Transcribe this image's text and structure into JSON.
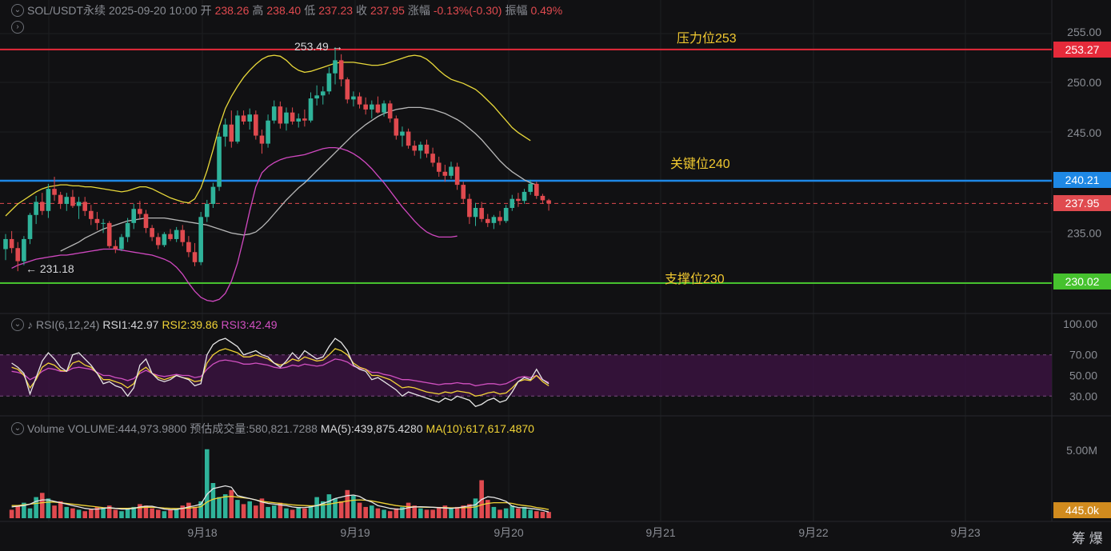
{
  "header": {
    "symbol": "SOL/USDT永续",
    "datetime": "2025-09-20 10:00",
    "open_label": "开",
    "open": "238.26",
    "high_label": "高",
    "high": "238.40",
    "low_label": "低",
    "low": "237.23",
    "close_label": "收",
    "close": "237.95",
    "change_label": "涨幅",
    "change": "-0.13%(-0.30)",
    "amp_label": "振幅",
    "amp": "0.49%"
  },
  "rsi_header": {
    "name": "RSI(6,12,24)",
    "rsi1": "RSI1:42.97",
    "rsi2": "RSI2:39.86",
    "rsi3": "RSI3:42.49"
  },
  "vol_header": {
    "name": "Volume",
    "volume": "VOLUME:444,973.9800",
    "est": "预估成交量:580,821.7288",
    "ma5": "MA(5):439,875.4280",
    "ma10": "MA(10):617,617.4870"
  },
  "levels": {
    "resistance": {
      "label": "压力位253",
      "value": "253.27",
      "price": 253.27
    },
    "key": {
      "label": "关键位240",
      "value": "240.21",
      "price": 240.21
    },
    "current": {
      "value": "237.95",
      "price": 237.95
    },
    "support": {
      "label": "支撑位230",
      "value": "230.02",
      "price": 230.02
    }
  },
  "annotations": {
    "high_marker": "253.49 →",
    "low_marker": "← 231.18"
  },
  "price_ticks": [
    "255.00",
    "250.00",
    "245.00",
    "235.00"
  ],
  "rsi_ticks": [
    "100.00",
    "70.00",
    "50.00",
    "30.00"
  ],
  "vol_ticks": [
    "5.00M"
  ],
  "vol_current": "445.0k",
  "date_ticks": [
    "9月18",
    "9月19",
    "9月20",
    "9月21",
    "9月22",
    "9月23"
  ],
  "corner": "筹 爆",
  "colors": {
    "up": "#2fb39a",
    "down": "#e04a4f",
    "boll_upper": "#e8d83a",
    "boll_mid": "#b8b8b8",
    "boll_lower": "#d048c0",
    "resistance": "#e52a3a",
    "key": "#1e88e5",
    "support": "#46c22e",
    "vol_tag": "#d18b1e"
  },
  "chart_data": {
    "type": "candlestick",
    "timeframe": "1h",
    "price_range": [
      225.0,
      257.0
    ],
    "candles": [
      [
        233.4,
        234.9,
        232.3,
        234.4
      ],
      [
        234.4,
        235.2,
        233.0,
        233.5
      ],
      [
        233.5,
        234.1,
        231.2,
        232.2
      ],
      [
        232.2,
        234.7,
        231.8,
        234.4
      ],
      [
        234.4,
        237.0,
        233.9,
        236.8
      ],
      [
        236.8,
        238.7,
        235.9,
        238.1
      ],
      [
        238.1,
        239.0,
        236.8,
        237.2
      ],
      [
        237.2,
        239.9,
        236.5,
        239.4
      ],
      [
        239.4,
        240.6,
        238.2,
        238.8
      ],
      [
        238.8,
        239.1,
        237.4,
        237.9
      ],
      [
        237.9,
        239.0,
        237.2,
        238.6
      ],
      [
        238.6,
        239.3,
        237.5,
        237.7
      ],
      [
        237.7,
        238.6,
        236.4,
        238.1
      ],
      [
        238.1,
        238.6,
        236.7,
        237.2
      ],
      [
        237.2,
        237.8,
        235.8,
        236.4
      ],
      [
        236.4,
        237.1,
        235.3,
        236.0
      ],
      [
        236.0,
        236.4,
        235.0,
        236.0
      ],
      [
        236.0,
        236.2,
        233.5,
        233.7
      ],
      [
        233.7,
        234.3,
        233.0,
        233.4
      ],
      [
        233.4,
        234.9,
        233.2,
        234.6
      ],
      [
        234.6,
        236.5,
        234.1,
        236.0
      ],
      [
        236.0,
        237.9,
        235.4,
        237.4
      ],
      [
        237.4,
        238.2,
        236.4,
        236.9
      ],
      [
        236.9,
        237.3,
        235.0,
        235.5
      ],
      [
        235.5,
        235.8,
        234.2,
        234.6
      ],
      [
        234.6,
        235.0,
        233.4,
        233.8
      ],
      [
        233.8,
        235.1,
        233.6,
        234.9
      ],
      [
        234.9,
        235.4,
        234.2,
        234.4
      ],
      [
        234.4,
        235.6,
        234.1,
        235.3
      ],
      [
        235.3,
        235.8,
        233.7,
        234.1
      ],
      [
        234.1,
        234.7,
        232.6,
        233.1
      ],
      [
        233.1,
        234.0,
        231.7,
        232.1
      ],
      [
        232.1,
        237.1,
        231.8,
        236.6
      ],
      [
        236.6,
        238.3,
        236.1,
        237.9
      ],
      [
        237.9,
        240.0,
        237.5,
        239.6
      ],
      [
        239.6,
        245.0,
        239.2,
        244.6
      ],
      [
        244.6,
        246.4,
        243.6,
        245.8
      ],
      [
        245.8,
        247.2,
        243.5,
        244.1
      ],
      [
        244.1,
        247.2,
        243.9,
        246.7
      ],
      [
        246.7,
        247.2,
        245.8,
        246.1
      ],
      [
        246.1,
        247.4,
        245.3,
        246.8
      ],
      [
        246.8,
        247.2,
        244.3,
        244.7
      ],
      [
        244.7,
        245.3,
        242.9,
        243.9
      ],
      [
        243.9,
        246.8,
        243.5,
        246.2
      ],
      [
        246.2,
        248.2,
        245.9,
        247.6
      ],
      [
        247.6,
        248.1,
        245.4,
        245.9
      ],
      [
        245.9,
        247.5,
        245.2,
        247.0
      ],
      [
        247.0,
        247.5,
        245.8,
        246.1
      ],
      [
        246.1,
        246.9,
        245.5,
        246.4
      ],
      [
        246.4,
        247.3,
        245.6,
        246.2
      ],
      [
        246.2,
        249.0,
        246.0,
        248.4
      ],
      [
        248.4,
        249.7,
        247.7,
        248.7
      ],
      [
        248.7,
        249.6,
        247.8,
        249.1
      ],
      [
        249.1,
        251.5,
        248.8,
        250.9
      ],
      [
        250.9,
        253.5,
        249.8,
        252.2
      ],
      [
        252.2,
        252.8,
        249.6,
        250.3
      ],
      [
        250.3,
        250.5,
        247.9,
        248.3
      ],
      [
        248.3,
        249.1,
        247.6,
        248.6
      ],
      [
        248.6,
        249.0,
        247.4,
        247.8
      ],
      [
        247.8,
        248.5,
        246.8,
        247.3
      ],
      [
        247.3,
        248.2,
        246.4,
        247.8
      ],
      [
        247.8,
        248.6,
        246.9,
        247.0
      ],
      [
        247.0,
        248.2,
        246.6,
        247.9
      ],
      [
        247.9,
        248.2,
        246.0,
        246.4
      ],
      [
        246.4,
        246.7,
        244.3,
        244.7
      ],
      [
        244.7,
        245.6,
        243.6,
        245.1
      ],
      [
        245.1,
        245.4,
        243.4,
        243.7
      ],
      [
        243.7,
        244.2,
        242.7,
        243.2
      ],
      [
        243.2,
        244.1,
        242.4,
        243.8
      ],
      [
        243.8,
        244.3,
        242.5,
        242.9
      ],
      [
        242.9,
        243.5,
        241.6,
        242.0
      ],
      [
        242.0,
        242.6,
        240.6,
        241.1
      ],
      [
        241.1,
        241.8,
        240.1,
        240.7
      ],
      [
        240.7,
        242.1,
        240.4,
        241.6
      ],
      [
        241.6,
        242.0,
        239.3,
        239.8
      ],
      [
        239.8,
        240.1,
        237.9,
        238.4
      ],
      [
        238.4,
        238.9,
        235.9,
        236.6
      ],
      [
        236.6,
        238.0,
        235.7,
        237.5
      ],
      [
        237.5,
        238.1,
        236.1,
        236.4
      ],
      [
        236.4,
        236.9,
        235.6,
        236.0
      ],
      [
        236.0,
        236.8,
        235.4,
        236.6
      ],
      [
        236.6,
        237.2,
        235.8,
        236.2
      ],
      [
        236.2,
        237.8,
        236.0,
        237.5
      ],
      [
        237.5,
        238.8,
        237.2,
        238.4
      ],
      [
        238.4,
        239.0,
        237.6,
        238.2
      ],
      [
        238.2,
        239.4,
        237.9,
        239.1
      ],
      [
        239.1,
        240.3,
        238.8,
        239.9
      ],
      [
        239.9,
        240.1,
        238.4,
        238.7
      ],
      [
        238.7,
        238.9,
        237.9,
        238.26
      ],
      [
        238.26,
        238.4,
        237.23,
        237.95
      ]
    ],
    "bollinger": {
      "upper": [
        236.7,
        237.3,
        237.9,
        238.3,
        238.7,
        239.1,
        239.4,
        239.6,
        239.7,
        239.8,
        239.8,
        239.7,
        239.7,
        239.6,
        239.6,
        239.5,
        239.4,
        239.3,
        239.2,
        239.1,
        239.2,
        239.4,
        239.6,
        239.6,
        239.4,
        239.1,
        238.8,
        238.5,
        238.3,
        238.1,
        238.0,
        238.4,
        239.5,
        241.2,
        243.3,
        245.6,
        247.4,
        248.6,
        249.6,
        250.5,
        251.2,
        251.8,
        252.3,
        252.6,
        252.7,
        252.6,
        252.2,
        251.6,
        251.2,
        251.0,
        251.1,
        251.3,
        251.5,
        251.7,
        251.9,
        252.0,
        252.0,
        252.0,
        251.9,
        251.8,
        251.7,
        251.7,
        251.8,
        252.0,
        252.2,
        252.4,
        252.6,
        252.7,
        252.6,
        252.3,
        251.8,
        251.2,
        250.7,
        250.3,
        250.1,
        249.9,
        249.6,
        249.3,
        248.8,
        248.2,
        247.6,
        246.9,
        246.2,
        245.5,
        245.0,
        244.6,
        244.2
      ],
      "middle": [
        233.2,
        233.5,
        233.8,
        234.1,
        234.5,
        234.8,
        235.1,
        235.4,
        235.6,
        235.8,
        236.0,
        236.2,
        236.3,
        236.4,
        236.5,
        236.5,
        236.5,
        236.5,
        236.4,
        236.3,
        236.2,
        236.1,
        236.0,
        235.9,
        235.8,
        235.6,
        235.4,
        235.2,
        235.0,
        234.9,
        234.8,
        234.9,
        235.1,
        235.6,
        236.2,
        236.9,
        237.6,
        238.3,
        238.9,
        239.5,
        240.0,
        240.6,
        241.2,
        241.8,
        242.4,
        243.0,
        243.6,
        244.2,
        244.8,
        245.3,
        245.8,
        246.2,
        246.6,
        246.9,
        247.1,
        247.3,
        247.4,
        247.5,
        247.5,
        247.5,
        247.4,
        247.3,
        247.1,
        246.9,
        246.6,
        246.3,
        245.9,
        245.4,
        244.9,
        244.3,
        243.6,
        242.9,
        242.2,
        241.6,
        241.1,
        240.7,
        240.3,
        240.0,
        239.8
      ],
      "lower": [
        231.5,
        231.8,
        232.0,
        232.2,
        232.4,
        232.5,
        232.6,
        232.7,
        232.8,
        232.8,
        232.9,
        233.0,
        233.1,
        233.2,
        233.3,
        233.4,
        233.4,
        233.4,
        233.3,
        233.2,
        233.1,
        233.0,
        232.9,
        232.8,
        232.6,
        232.4,
        232.1,
        231.6,
        230.9,
        230.0,
        229.2,
        228.6,
        228.3,
        228.2,
        228.4,
        229.0,
        230.2,
        232.0,
        234.5,
        237.2,
        239.6,
        241.0,
        241.6,
        242.0,
        242.3,
        242.5,
        242.6,
        242.7,
        242.8,
        243.0,
        243.2,
        243.4,
        243.5,
        243.5,
        243.4,
        243.2,
        242.9,
        242.5,
        242.0,
        241.4,
        240.7,
        240.0,
        239.2,
        238.4,
        237.6,
        236.9,
        236.2,
        235.6,
        235.1,
        234.8,
        234.6,
        234.6,
        234.6,
        234.7
      ]
    },
    "rsi": {
      "range": [
        0,
        100
      ],
      "rsi1": [
        62,
        58,
        52,
        32,
        48,
        64,
        72,
        66,
        58,
        54,
        70,
        72,
        66,
        60,
        52,
        42,
        44,
        40,
        38,
        30,
        38,
        60,
        66,
        52,
        46,
        44,
        46,
        50,
        48,
        46,
        40,
        42,
        70,
        80,
        84,
        86,
        82,
        78,
        70,
        72,
        74,
        70,
        68,
        62,
        58,
        64,
        72,
        66,
        74,
        70,
        66,
        68,
        78,
        86,
        82,
        74,
        60,
        56,
        54,
        46,
        48,
        44,
        40,
        36,
        30,
        34,
        32,
        30,
        28,
        26,
        24,
        28,
        26,
        30,
        28,
        26,
        20,
        22,
        26,
        28,
        24,
        26,
        34,
        44,
        48,
        46,
        56,
        46,
        42
      ],
      "rsi2": [
        58,
        56,
        50,
        38,
        46,
        58,
        62,
        60,
        55,
        54,
        62,
        64,
        60,
        58,
        52,
        46,
        46,
        44,
        42,
        38,
        42,
        54,
        58,
        52,
        48,
        46,
        48,
        50,
        48,
        47,
        44,
        45,
        62,
        70,
        74,
        76,
        74,
        72,
        68,
        68,
        70,
        68,
        66,
        62,
        60,
        62,
        66,
        64,
        68,
        66,
        64,
        65,
        70,
        76,
        74,
        70,
        62,
        58,
        56,
        50,
        50,
        48,
        46,
        42,
        38,
        39,
        38,
        36,
        34,
        33,
        32,
        34,
        33,
        35,
        34,
        33,
        30,
        31,
        33,
        34,
        32,
        33,
        38,
        44,
        46,
        45,
        50,
        44,
        40
      ],
      "rsi3": [
        54,
        53,
        51,
        46,
        49,
        54,
        57,
        56,
        54,
        54,
        57,
        58,
        57,
        56,
        53,
        50,
        50,
        48,
        47,
        45,
        47,
        52,
        55,
        52,
        50,
        49,
        50,
        51,
        50,
        50,
        48,
        49,
        56,
        61,
        64,
        65,
        64,
        63,
        61,
        61,
        62,
        61,
        60,
        58,
        57,
        58,
        60,
        59,
        61,
        60,
        59,
        60,
        63,
        66,
        65,
        63,
        59,
        57,
        56,
        53,
        53,
        51,
        50,
        48,
        46,
        46,
        45,
        44,
        43,
        42,
        41,
        42,
        42,
        43,
        42,
        42,
        40,
        41,
        42,
        42,
        41,
        42,
        45,
        48,
        49,
        48,
        50,
        46,
        43
      ]
    },
    "volume": {
      "values_k": [
        600,
        900,
        1100,
        700,
        1500,
        1800,
        1400,
        900,
        1200,
        800,
        700,
        600,
        500,
        650,
        800,
        700,
        900,
        600,
        500,
        700,
        800,
        1000,
        900,
        700,
        600,
        500,
        600,
        700,
        900,
        1100,
        800,
        1200,
        4900,
        2500,
        1500,
        1700,
        2000,
        1300,
        1000,
        1200,
        900,
        1400,
        800,
        900,
        1100,
        700,
        600,
        800,
        700,
        900,
        1500,
        1200,
        1700,
        1400,
        1200,
        2000,
        1600,
        1100,
        800,
        900,
        700,
        600,
        500,
        700,
        800,
        1100,
        900,
        700,
        600,
        600,
        800,
        900,
        700,
        800,
        900,
        1000,
        1400,
        2700,
        1300,
        800,
        600,
        700,
        900,
        700,
        800,
        600,
        500,
        450,
        445
      ],
      "ma5_k": [
        800,
        850,
        900,
        1000,
        1200,
        1300,
        1300,
        1200,
        1100,
        1000,
        900,
        800,
        700,
        650,
        650,
        700,
        750,
        700,
        650,
        650,
        700,
        800,
        850,
        850,
        750,
        650,
        600,
        620,
        700,
        800,
        880,
        1000,
        1700,
        2100,
        2200,
        2300,
        2200,
        1600,
        1500,
        1400,
        1300,
        1150,
        1050,
        1000,
        950,
        900,
        800,
        750,
        760,
        800,
        900,
        1050,
        1200,
        1400,
        1500,
        1600,
        1650,
        1550,
        1300,
        1150,
        900,
        800,
        700,
        650,
        650,
        750,
        800,
        820,
        800,
        780,
        750,
        720,
        700,
        740,
        800,
        880,
        950,
        1330,
        1520,
        1480,
        1360,
        1200,
        860,
        760,
        740,
        700,
        640,
        560,
        440
      ],
      "ma10_k": [
        900,
        900,
        950,
        1000,
        1050,
        1100,
        1150,
        1150,
        1100,
        1050,
        1000,
        950,
        900,
        850,
        800,
        750,
        720,
        700,
        700,
        700,
        720,
        750,
        780,
        780,
        760,
        720,
        700,
        690,
        700,
        720,
        760,
        820,
        1150,
        1350,
        1450,
        1520,
        1550,
        1500,
        1450,
        1400,
        1300,
        1200,
        1150,
        1100,
        1050,
        1000,
        950,
        920,
        900,
        880,
        900,
        950,
        1000,
        1080,
        1150,
        1220,
        1280,
        1300,
        1280,
        1230,
        1150,
        1060,
        980,
        900,
        850,
        820,
        800,
        790,
        780,
        770,
        760,
        750,
        740,
        740,
        750,
        760,
        800,
        950,
        1050,
        1100,
        1100,
        1100,
        1050,
        960,
        900,
        850,
        760,
        700,
        618
      ]
    }
  }
}
